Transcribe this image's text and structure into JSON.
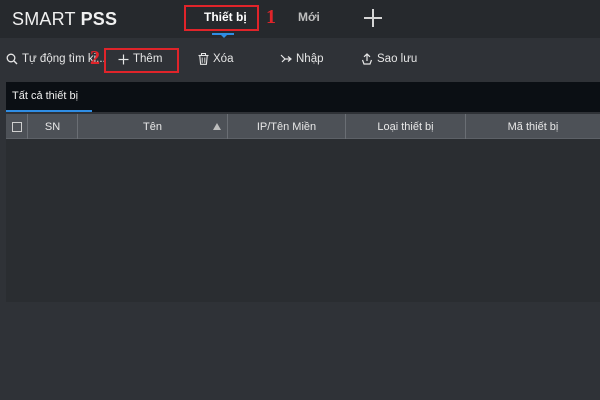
{
  "app": {
    "logo_light": "SMART ",
    "logo_bold": "PSS"
  },
  "tabs": {
    "active": "Thiết bị",
    "inactive": "Mới"
  },
  "annotations": {
    "marker1": "1",
    "marker2": "2",
    "color": "#e0242a"
  },
  "toolbar": {
    "search_label": "Tự động tìm ki...",
    "add_label": "Thêm",
    "delete_label": "Xóa",
    "import_label": "Nhập",
    "backup_label": "Sao lưu"
  },
  "subtabs": {
    "all_devices": "Tất cả thiết bị"
  },
  "table": {
    "columns": [
      "SN",
      "Tên",
      "IP/Tên Miền",
      "Loại thiết bị",
      "Mã thiết bị"
    ],
    "rows": []
  },
  "colors": {
    "accent": "#2f8de4",
    "background": "#2f3237",
    "header_bg": "#4d5157"
  },
  "icons": {
    "search": "search-icon",
    "add": "plus-icon",
    "delete": "trash-icon",
    "import": "import-icon",
    "backup": "backup-icon",
    "new_tab": "plus-icon",
    "sort": "sort-asc-icon"
  }
}
